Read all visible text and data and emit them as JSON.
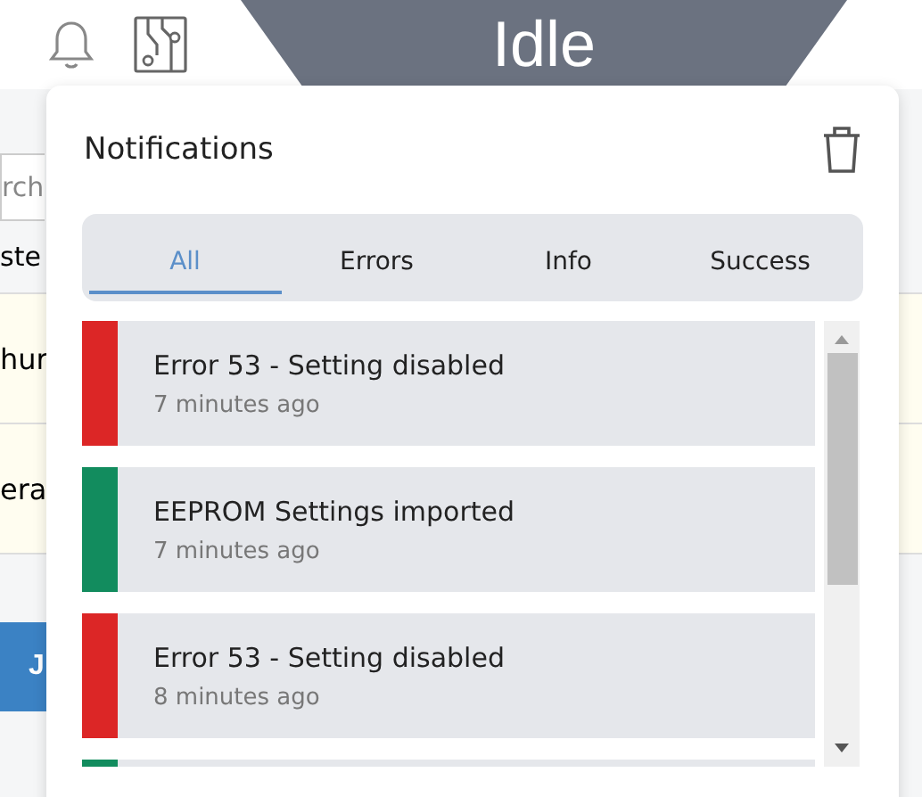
{
  "status": {
    "label": "Idle"
  },
  "background_page": {
    "search": {
      "placeholder": "rch"
    },
    "table_header": "ste",
    "rows": [
      "hur",
      "era"
    ],
    "button": "J"
  },
  "notifications": {
    "title": "Notifications",
    "tabs": [
      {
        "label": "All",
        "selected": true
      },
      {
        "label": "Errors",
        "selected": false
      },
      {
        "label": "Info",
        "selected": false
      },
      {
        "label": "Success",
        "selected": false
      }
    ],
    "items": [
      {
        "color": "#dc2626",
        "message": "Error 53 - Setting disabled",
        "time": "7 minutes ago"
      },
      {
        "color": "#128c5e",
        "message": "EEPROM Settings imported",
        "time": "7 minutes ago"
      },
      {
        "color": "#dc2626",
        "message": "Error 53 - Setting disabled",
        "time": "8 minutes ago"
      },
      {
        "color": "#128c5e"
      }
    ]
  }
}
